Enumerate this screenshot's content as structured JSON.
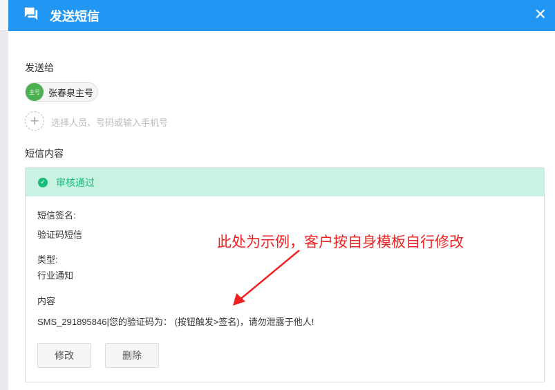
{
  "header": {
    "title": "发送短信",
    "icon": "chat-icon",
    "close": "✕"
  },
  "recipients": {
    "label": "发送给",
    "chips": [
      {
        "avatar": "主号",
        "name": "张春泉主号"
      }
    ],
    "add_placeholder": "选择人员、号码或输入手机号"
  },
  "content": {
    "label": "短信内容",
    "status": "审核通过",
    "status_color": "#1abc7b",
    "signature_label": "短信签名:",
    "signature": "验证码短信",
    "type_label": "类型:",
    "type": "行业通知",
    "body_label": "内容",
    "body": "SMS_291895846|您的验证码为： (按钮触发>签名)，请勿泄露于他人!",
    "edit": "修改",
    "delete": "删除"
  },
  "annotation": "此处为示例，客户按自身模板自行修改"
}
